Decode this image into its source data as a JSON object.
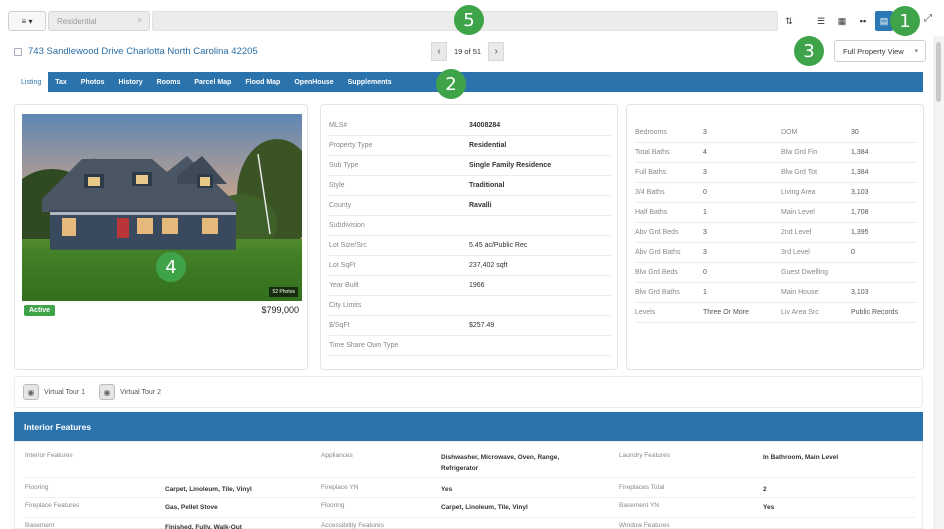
{
  "toolbar": {
    "menu_label": "≡ ▾",
    "property_type_select": "Residential",
    "clear_icon": "×",
    "view_buttons": [
      {
        "icon": "filter-icon",
        "glyph": "⇅"
      },
      {
        "icon": "list-view-icon",
        "glyph": "☰"
      },
      {
        "icon": "table-view-icon",
        "glyph": "▦"
      },
      {
        "icon": "grid-view-icon",
        "glyph": "▪▪"
      },
      {
        "icon": "document-view-icon",
        "glyph": "▤"
      }
    ],
    "close_glyph": "⤢"
  },
  "callouts": [
    "1",
    "2",
    "3",
    "4",
    "5"
  ],
  "header": {
    "address": "743 Sandlewood Drive Charlotta North Carolina 42205",
    "pager_text": "19 of 51",
    "prev_glyph": "‹",
    "next_glyph": "›",
    "view_select": "Full Property View",
    "view_caret": "▾"
  },
  "tabs": [
    "Listing",
    "Tax",
    "Photos",
    "History",
    "Rooms",
    "Parcel Map",
    "Flood Map",
    "OpenHouse",
    "Supplements"
  ],
  "active_tab": 0,
  "photo": {
    "photo_count": "52 Photos",
    "status": "Active",
    "price": "$799,000"
  },
  "details": [
    {
      "label": "MLS#",
      "value": "34008284",
      "bold": true
    },
    {
      "label": "Property Type",
      "value": "Residential",
      "bold": true
    },
    {
      "label": "Sub Type",
      "value": "Single Family Residence",
      "bold": true
    },
    {
      "label": "Style",
      "value": "Traditional",
      "bold": true
    },
    {
      "label": "County",
      "value": "Ravalli",
      "bold": true
    },
    {
      "label": "Subdivision",
      "value": "",
      "bold": false
    },
    {
      "label": "Lot Size/Src",
      "value": "5.45 ac/Public Rec",
      "bold": false
    },
    {
      "label": "Lot SqFt",
      "value": "237,402 sqft",
      "bold": false
    },
    {
      "label": "Year Built",
      "value": "1966",
      "bold": false
    },
    {
      "label": "City Limits",
      "value": "",
      "bold": false
    },
    {
      "label": "$/SqFt",
      "value": "$257.49",
      "bold": false
    },
    {
      "label": "Time Share Own Type",
      "value": "",
      "bold": false
    }
  ],
  "stats": [
    {
      "l1": "Bedrooms",
      "v1": "3",
      "l2": "DOM",
      "v2": "30"
    },
    {
      "l1": "Total Baths",
      "v1": "4",
      "l2": "Blw Grd Fin",
      "v2": "1,384"
    },
    {
      "l1": "Full Baths",
      "v1": "3",
      "l2": "Blw Grd Tot",
      "v2": "1,384"
    },
    {
      "l1": "3/4 Baths",
      "v1": "0",
      "l2": "Living Area",
      "v2": "3,103"
    },
    {
      "l1": "Half Baths",
      "v1": "1",
      "l2": "Main Level",
      "v2": "1,708"
    },
    {
      "l1": "Abv Grd Beds",
      "v1": "3",
      "l2": "2nd Level",
      "v2": "1,395"
    },
    {
      "l1": "Abv Grd Baths",
      "v1": "3",
      "l2": "3rd Level",
      "v2": "0"
    },
    {
      "l1": "Blw Grd Beds",
      "v1": "0",
      "l2": "Guest Dwelling",
      "v2": ""
    },
    {
      "l1": "Blw Grd Baths",
      "v1": "1",
      "l2": "Main House",
      "v2": "3,103"
    },
    {
      "l1": "Levels",
      "v1": "Three Or More",
      "l2": "Liv Area Src",
      "v2": "Public Records"
    }
  ],
  "tours": [
    {
      "label": "Virtual Tour 1",
      "icon": "virtual-tour-icon"
    },
    {
      "label": "Virtual Tour 2",
      "icon": "virtual-tour-icon"
    }
  ],
  "interior": {
    "title": "Interior Features",
    "rows": [
      {
        "l1": "Interior Features",
        "v1": "",
        "l2": "Appliances",
        "v2": "Dishwasher, Microwave, Oven, Range, Refrigerator",
        "l3": "Laundry Features",
        "v3": "In Bathroom, Main Level"
      },
      {
        "l1": "Flooring",
        "v1": "Carpet, Linoleum, Tile, Vinyl",
        "l2": "Fireplace YN",
        "v2": "Yes",
        "l3": "Fireplaces Total",
        "v3": "2"
      },
      {
        "l1": "Fireplace Features",
        "v1": "Gas, Pellet Stove",
        "l2": "Flooring",
        "v2": "Carpet, Linoleum, Tile, Vinyl",
        "l3": "Basement YN",
        "v3": "Yes"
      },
      {
        "l1": "Basement",
        "v1": "Finished, Fully, Walk-Out",
        "l2": "Accessibility Features",
        "v2": "",
        "l3": "Window Features",
        "v3": ""
      }
    ]
  }
}
